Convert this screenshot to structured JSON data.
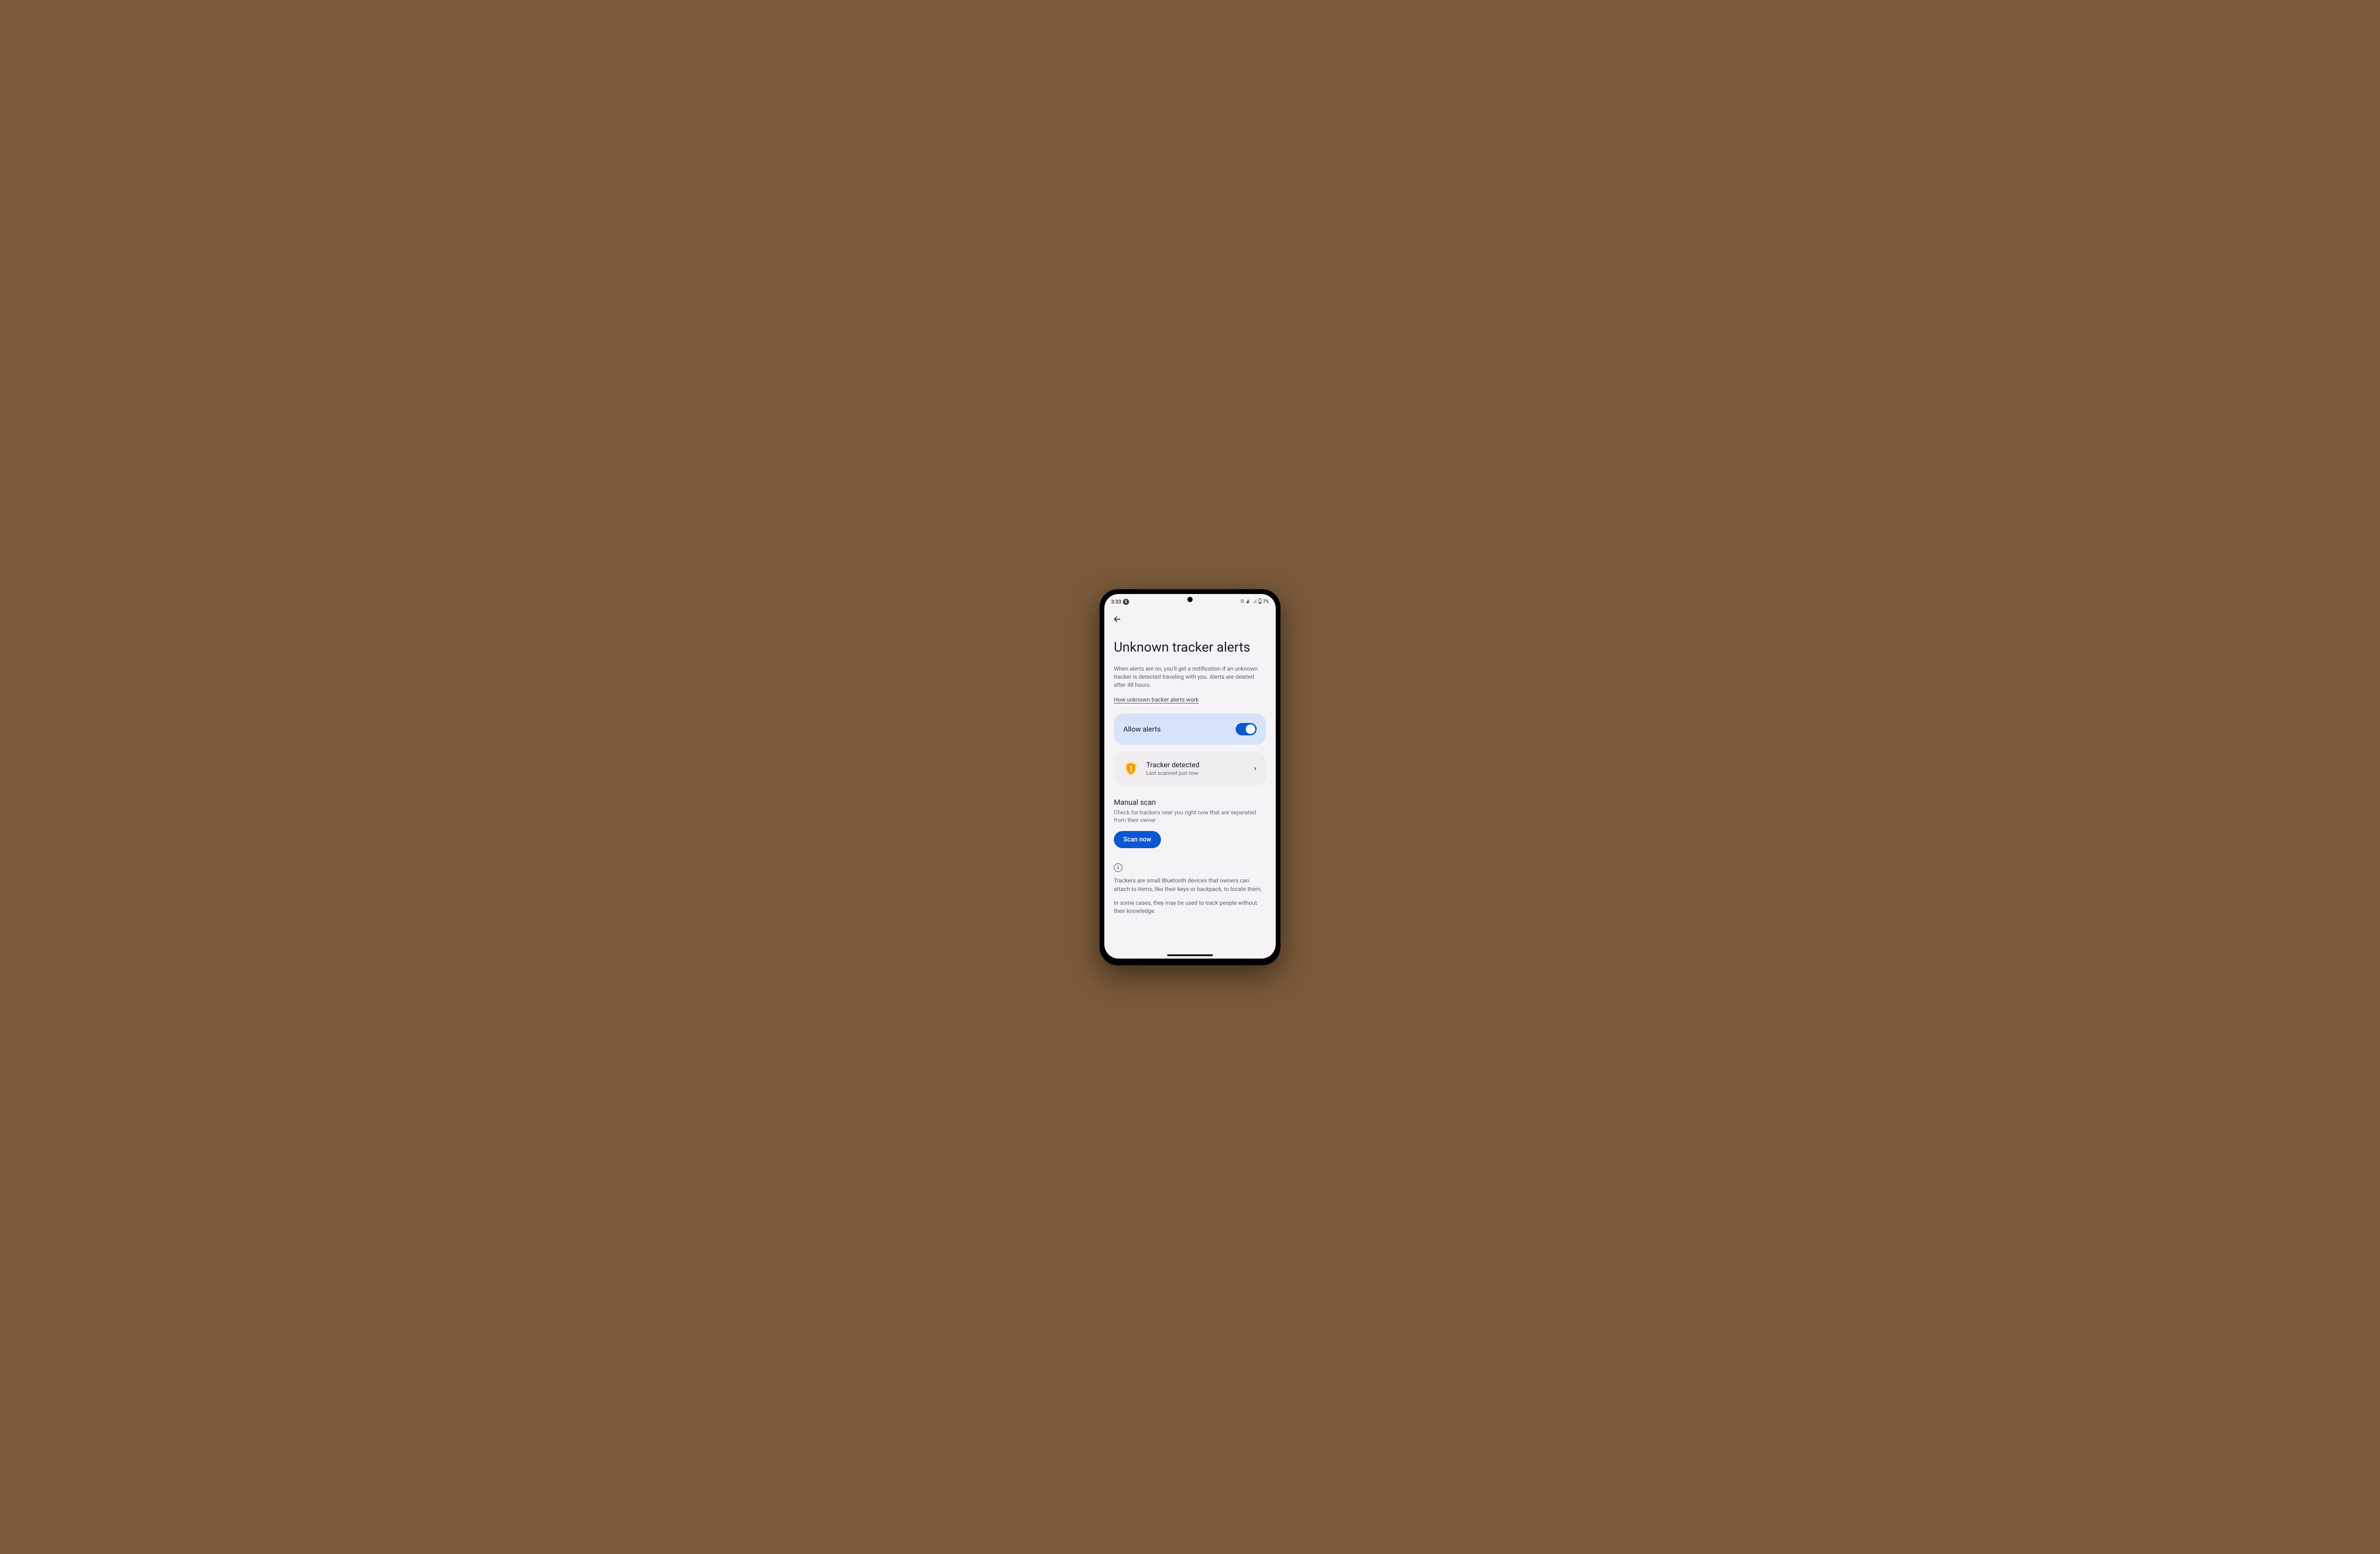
{
  "status": {
    "time": "3:33",
    "notif_count": "5",
    "battery": "7%"
  },
  "header": {
    "title": "Unknown tracker alerts"
  },
  "description": "When alerts are on, you'll get a notification if an unknown tracker is detected traveling with you. Alerts are deleted after 48 hours.",
  "link": "How unknown tracker alerts work",
  "allow_card": {
    "label": "Allow alerts",
    "on": true
  },
  "detected_card": {
    "title": "Tracker detected",
    "subtitle": "Last scanned just now"
  },
  "manual_scan": {
    "title": "Manual scan",
    "subtitle": "Check for trackers near you right now that are separated from their owner",
    "button": "Scan now"
  },
  "info": {
    "p1": "Trackers are small Bluetooth devices that owners can attach to items, like their keys or backpack, to locate them.",
    "p2": "In some cases, they may be used to track people without their knowledge."
  }
}
